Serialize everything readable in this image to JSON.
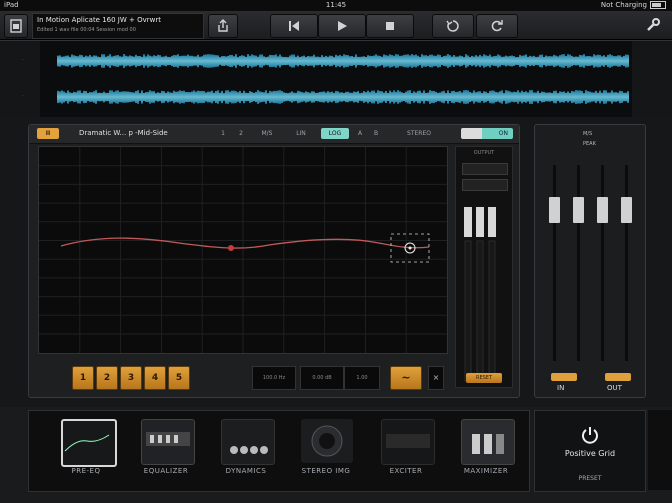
{
  "status": {
    "carrier": "iPad",
    "time": "11:45",
    "battery": "Not Charging"
  },
  "toolbar": {
    "title_line1": "In Motion Aplicate 160 JW + Ovrwrt",
    "title_line2": "Edited 1 wav file 00:04 Session mod 00",
    "buttons": [
      "save",
      "rewind",
      "play",
      "stop",
      "loop",
      "reload",
      "settings"
    ]
  },
  "eq": {
    "enable_label": "II",
    "preset_name": "Dramatic W... p -Mid-Side",
    "header_buttons": [
      "1",
      "2",
      "M/S",
      "LIN",
      "LOG",
      "A",
      "B"
    ],
    "stereo_label": "STEREO",
    "toggle_label": "ON",
    "bands": [
      "1",
      "2",
      "3",
      "4",
      "5"
    ],
    "readouts": [
      "100.0 Hz",
      "0.00 dB",
      "1.00"
    ],
    "shape_button": "∼",
    "close_button": "×",
    "output_label": "OUTPUT",
    "reset_label": "RESET"
  },
  "mixer": {
    "header": [
      "M/S",
      "PEAK"
    ],
    "in_label": "IN",
    "out_label": "OUT"
  },
  "modules": [
    {
      "label": "PRE-EQ"
    },
    {
      "label": "EQUALIZER"
    },
    {
      "label": "DYNAMICS"
    },
    {
      "label": "STEREO IMG"
    },
    {
      "label": "EXCITER"
    },
    {
      "label": "MAXIMIZER"
    }
  ],
  "power": {
    "label": "Positive Grid",
    "preset": "PRESET"
  }
}
